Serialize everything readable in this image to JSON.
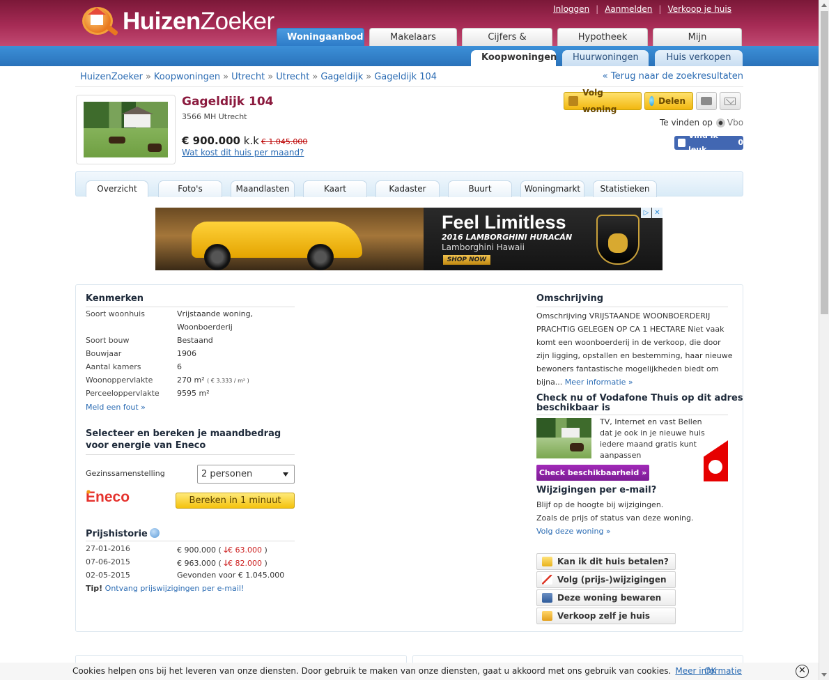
{
  "brand": {
    "logo_bold": "Huizen",
    "logo_light": "Zoeker"
  },
  "top_links": [
    "Inloggen",
    "Aanmelden",
    "Verkoop je huis"
  ],
  "main_nav": [
    "Woningaanbod",
    "Makelaars",
    "Cijfers & Trends",
    "Hypotheek",
    "Mijn HuizenZoeker"
  ],
  "sub_nav": [
    "Koopwoningen",
    "Huurwoningen",
    "Huis verkopen"
  ],
  "breadcrumb": [
    "HuizenZoeker",
    "Koopwoningen",
    "Utrecht",
    "Utrecht",
    "Gageldijk",
    "Gageldijk 104"
  ],
  "back_link": "« Terug naar de zoekresultaten",
  "property": {
    "title": "Gageldijk 104",
    "address": "3566 MH Utrecht",
    "price": "€ 900.000",
    "price_suffix": "k.k",
    "old_price": "€ 1.045.000",
    "monthly_link": "Wat kost dit huis per maand?"
  },
  "actions": {
    "follow": "Volg woning",
    "share": "Delen",
    "found_on": "Te vinden op",
    "source": "Vbo",
    "like": "Vind ik leuk",
    "like_count": "0"
  },
  "detail_tabs": [
    "Overzicht",
    "Foto's",
    "Maandlasten",
    "Kaart",
    "Kadaster",
    "Buurt",
    "Woningmarkt",
    "Statistieken"
  ],
  "ad": {
    "headline": "Feel Limitless",
    "model": "2016 LAMBORGHINI HURACÁN",
    "dealer": "Lamborghini Hawaii",
    "cta": "SHOP NOW",
    "brand": "LAMBORGHINI"
  },
  "kenmerken": {
    "title": "Kenmerken",
    "rows": [
      {
        "k": "Soort woonhuis",
        "v": "Vrijstaande woning,"
      },
      {
        "k": "",
        "v": "Woonboerderij"
      },
      {
        "k": "Soort bouw",
        "v": "Bestaand"
      },
      {
        "k": "Bouwjaar",
        "v": "1906"
      },
      {
        "k": "Aantal kamers",
        "v": "6"
      },
      {
        "k": "Woonoppervlakte",
        "v": "270 m²",
        "extra": "( € 3.333 / m² )"
      },
      {
        "k": "Perceeloppervlakte",
        "v": "9595 m²"
      }
    ],
    "report": "Meld een fout »"
  },
  "energy": {
    "title_1": "Selecteer en bereken je maandbedrag",
    "title_2": "voor energie van Eneco",
    "label": "Gezinssamenstelling",
    "selected": "2 personen",
    "logo": "Eneco",
    "button": "Bereken in 1 minuut"
  },
  "history": {
    "title": "Prijshistorie",
    "rows": [
      {
        "date": "27-01-2016",
        "price": "€ 900.000",
        "change": "€ 63.000"
      },
      {
        "date": "07-06-2015",
        "price": "€ 963.000",
        "change": "€ 82.000"
      },
      {
        "date": "02-05-2015",
        "price": "Gevonden voor € 1.045.000",
        "change": ""
      }
    ],
    "tip_label": "Tip!",
    "tip_link": "Ontvang prijswijzigingen per e-mail!"
  },
  "description": {
    "title": "Omschrijving",
    "lines": [
      "Omschrijving VRIJSTAANDE WOONBOERDERIJ",
      "PRACHTIG GELEGEN OP CA 1 HECTARE Niet vaak",
      "komt een woonboerderij in de verkoop, die door",
      "zijn ligging, opstallen en bestemming, haar nieuwe",
      "bewoners fantastische mogelijkheden biedt om",
      "bijna..."
    ],
    "more": "Meer informatie »"
  },
  "vodafone": {
    "title_1": "Check nu of Vodafone Thuis op dit adres",
    "title_2": "beschikbaar is",
    "lines": [
      "TV, Internet en vast Bellen",
      "dat je ook in je nieuwe huis",
      "iedere maand gratis kunt",
      "aanpassen"
    ],
    "button": "Check beschikbaarheid »"
  },
  "email": {
    "title": "Wijzigingen per e-mail?",
    "line1": "Blijf op de hoogte bij wijzigingen.",
    "line2": "Zoals de prijs of status van deze woning.",
    "link": "Volg deze woning »"
  },
  "side_buttons": [
    "Kan ik dit huis betalen?",
    "Volg (prijs-)wijzigingen",
    "Deze woning bewaren",
    "Verkoop zelf je huis"
  ],
  "cookie": {
    "text": "Cookies helpen ons bij het leveren van onze diensten. Door gebruik te maken van onze diensten, gaat u akkoord met ons gebruik van cookies.",
    "more": "Meer informatie",
    "ok": "OK"
  }
}
